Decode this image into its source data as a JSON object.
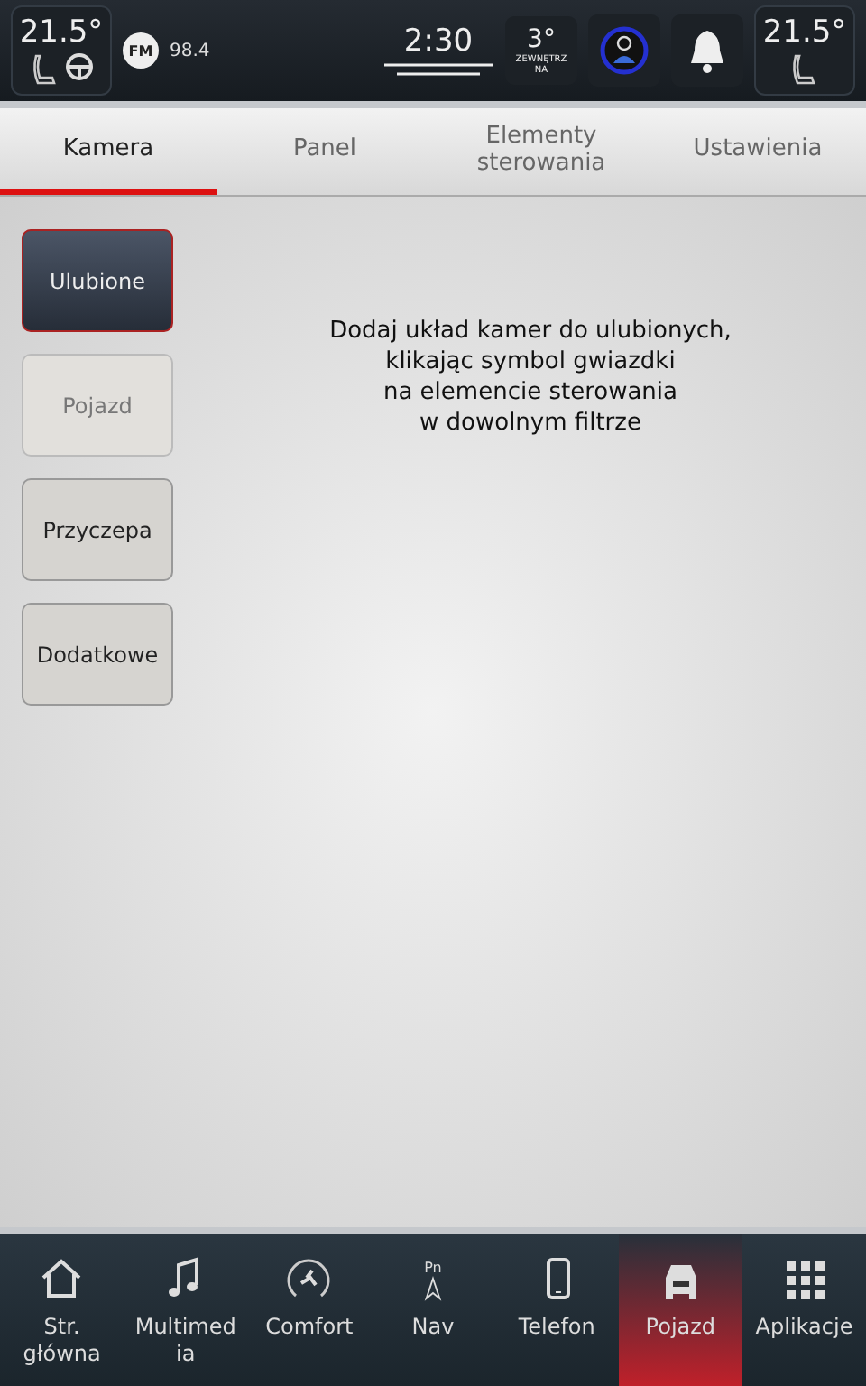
{
  "status_bar": {
    "left_climate": {
      "temperature": "21.5°"
    },
    "radio": {
      "band": "FM",
      "frequency": "98.4"
    },
    "clock": "2:30",
    "outside": {
      "temperature": "3°",
      "label": "ZEWNĘTRZ",
      "sub": "NA"
    },
    "right_climate": {
      "temperature": "21.5°"
    }
  },
  "tabs": [
    {
      "label": "Kamera",
      "selected": true
    },
    {
      "label": "Panel",
      "selected": false
    },
    {
      "label": "Elementy sterowania",
      "selected": false
    },
    {
      "label": "Ustawienia",
      "selected": false
    }
  ],
  "filters": [
    {
      "label": "Ulubione",
      "selected": true,
      "disabled": false
    },
    {
      "label": "Pojazd",
      "selected": false,
      "disabled": true
    },
    {
      "label": "Przyczepa",
      "selected": false,
      "disabled": false
    },
    {
      "label": "Dodatkowe",
      "selected": false,
      "disabled": false
    }
  ],
  "message": [
    "Dodaj układ kamer do ulubionych,",
    "klikając symbol gwiazdki",
    "na elemencie sterowania",
    "w dowolnym filtrze"
  ],
  "nav": [
    {
      "kind": "home",
      "label": "Str. główna",
      "selected": false
    },
    {
      "kind": "music",
      "label": "Multimed ia",
      "selected": false
    },
    {
      "kind": "comfort",
      "label": "Comfort",
      "selected": false
    },
    {
      "kind": "nav",
      "label": "Nav",
      "badge": "Pn",
      "selected": false
    },
    {
      "kind": "phone",
      "label": "Telefon",
      "selected": false
    },
    {
      "kind": "vehicle",
      "label": "Pojazd",
      "selected": true
    },
    {
      "kind": "apps",
      "label": "Aplikacje",
      "selected": false
    }
  ]
}
